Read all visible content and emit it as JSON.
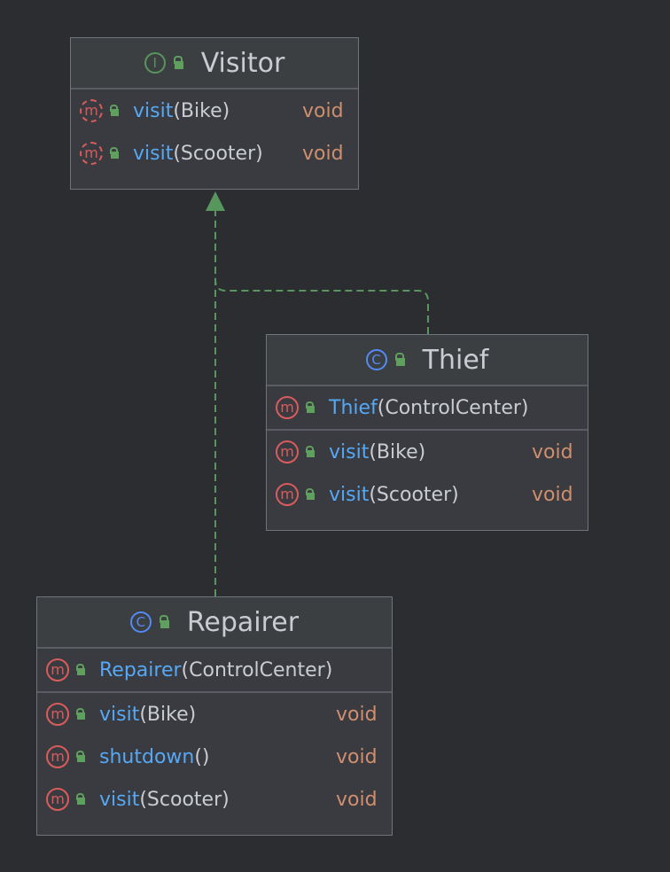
{
  "colors": {
    "background": "#2b2d30",
    "edge": "#57965c",
    "method_name": "#56a8f5",
    "return_type": "#cf8e6d",
    "text": "#c9ccd1",
    "interface_badge": "#57965c",
    "class_badge": "#548af7",
    "method_badge": "#d95c5c"
  },
  "nodes": {
    "visitor": {
      "kind": "I",
      "kind_icon": "interface-icon",
      "title": "Visitor",
      "methods": [
        {
          "name": "visit",
          "params": "(Bike)",
          "returns": "void"
        },
        {
          "name": "visit",
          "params": "(Scooter)",
          "returns": "void"
        }
      ]
    },
    "thief": {
      "kind": "C",
      "kind_icon": "class-icon",
      "title": "Thief",
      "constructor": {
        "name": "Thief",
        "params": "(ControlCenter)"
      },
      "methods": [
        {
          "name": "visit",
          "params": "(Bike)",
          "returns": "void"
        },
        {
          "name": "visit",
          "params": "(Scooter)",
          "returns": "void"
        }
      ]
    },
    "repairer": {
      "kind": "C",
      "kind_icon": "class-icon",
      "title": "Repairer",
      "constructor": {
        "name": "Repairer",
        "params": "(ControlCenter)"
      },
      "methods": [
        {
          "name": "visit",
          "params": "(Bike)",
          "returns": "void"
        },
        {
          "name": "shutdown",
          "params": "()",
          "returns": "void"
        },
        {
          "name": "visit",
          "params": "(Scooter)",
          "returns": "void"
        }
      ]
    }
  },
  "method_badge": "m",
  "edges": [
    {
      "from": "thief",
      "to": "visitor",
      "type": "realization"
    },
    {
      "from": "repairer",
      "to": "visitor",
      "type": "realization"
    }
  ]
}
